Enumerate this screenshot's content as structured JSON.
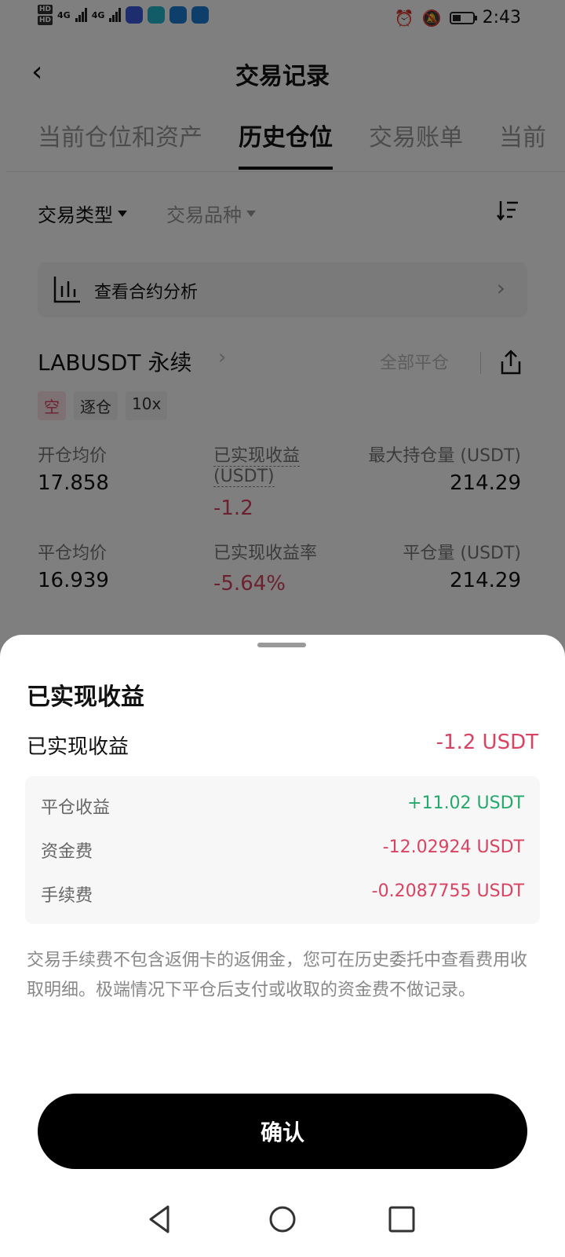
{
  "status_bar": {
    "hd_top": "HD",
    "hd_bottom": "HD",
    "net1": "4G",
    "net2": "4G",
    "time": "2:43"
  },
  "header": {
    "title": "交易记录"
  },
  "tabs": [
    {
      "label": "当前仓位和资产"
    },
    {
      "label": "历史仓位"
    },
    {
      "label": "交易账单"
    },
    {
      "label": "当前"
    }
  ],
  "filters": {
    "type": "交易类型",
    "variety": "交易品种"
  },
  "analysis": {
    "label": "查看合约分析"
  },
  "position": {
    "pair": "LABUSDT 永续",
    "close_all": "全部平仓",
    "tags": [
      "空",
      "逐仓",
      "10x"
    ],
    "fields": {
      "open_avg_label": "开仓均价",
      "open_avg": "17.858",
      "realized_label": "已实现收益",
      "realized_unit": "(USDT)",
      "realized": "-1.2",
      "max_hold_label": "最大持仓量 (USDT)",
      "max_hold": "214.29",
      "close_avg_label": "平仓均价",
      "close_avg": "16.939",
      "realized_rate_label": "已实现收益率",
      "realized_rate": "-5.64%",
      "close_amount_label": "平仓量 (USDT)",
      "close_amount": "214.29"
    }
  },
  "sheet": {
    "title": "已实现收益",
    "summary_label": "已实现收益",
    "summary_value": "-1.2 USDT",
    "rows": [
      {
        "label": "平仓收益",
        "value": "+11.02 USDT"
      },
      {
        "label": "资金费",
        "value": "-12.02924 USDT"
      },
      {
        "label": "手续费",
        "value": "-0.2087755 USDT"
      }
    ],
    "note": "交易手续费不包含返佣卡的返佣金，您可在历史委托中查看费用收取明细。极端情况下平仓后支付或收取的资金费不做记录。",
    "confirm": "确认"
  },
  "colors": {
    "negative": "#d94361",
    "positive": "#24a86b",
    "button": "#000000"
  }
}
